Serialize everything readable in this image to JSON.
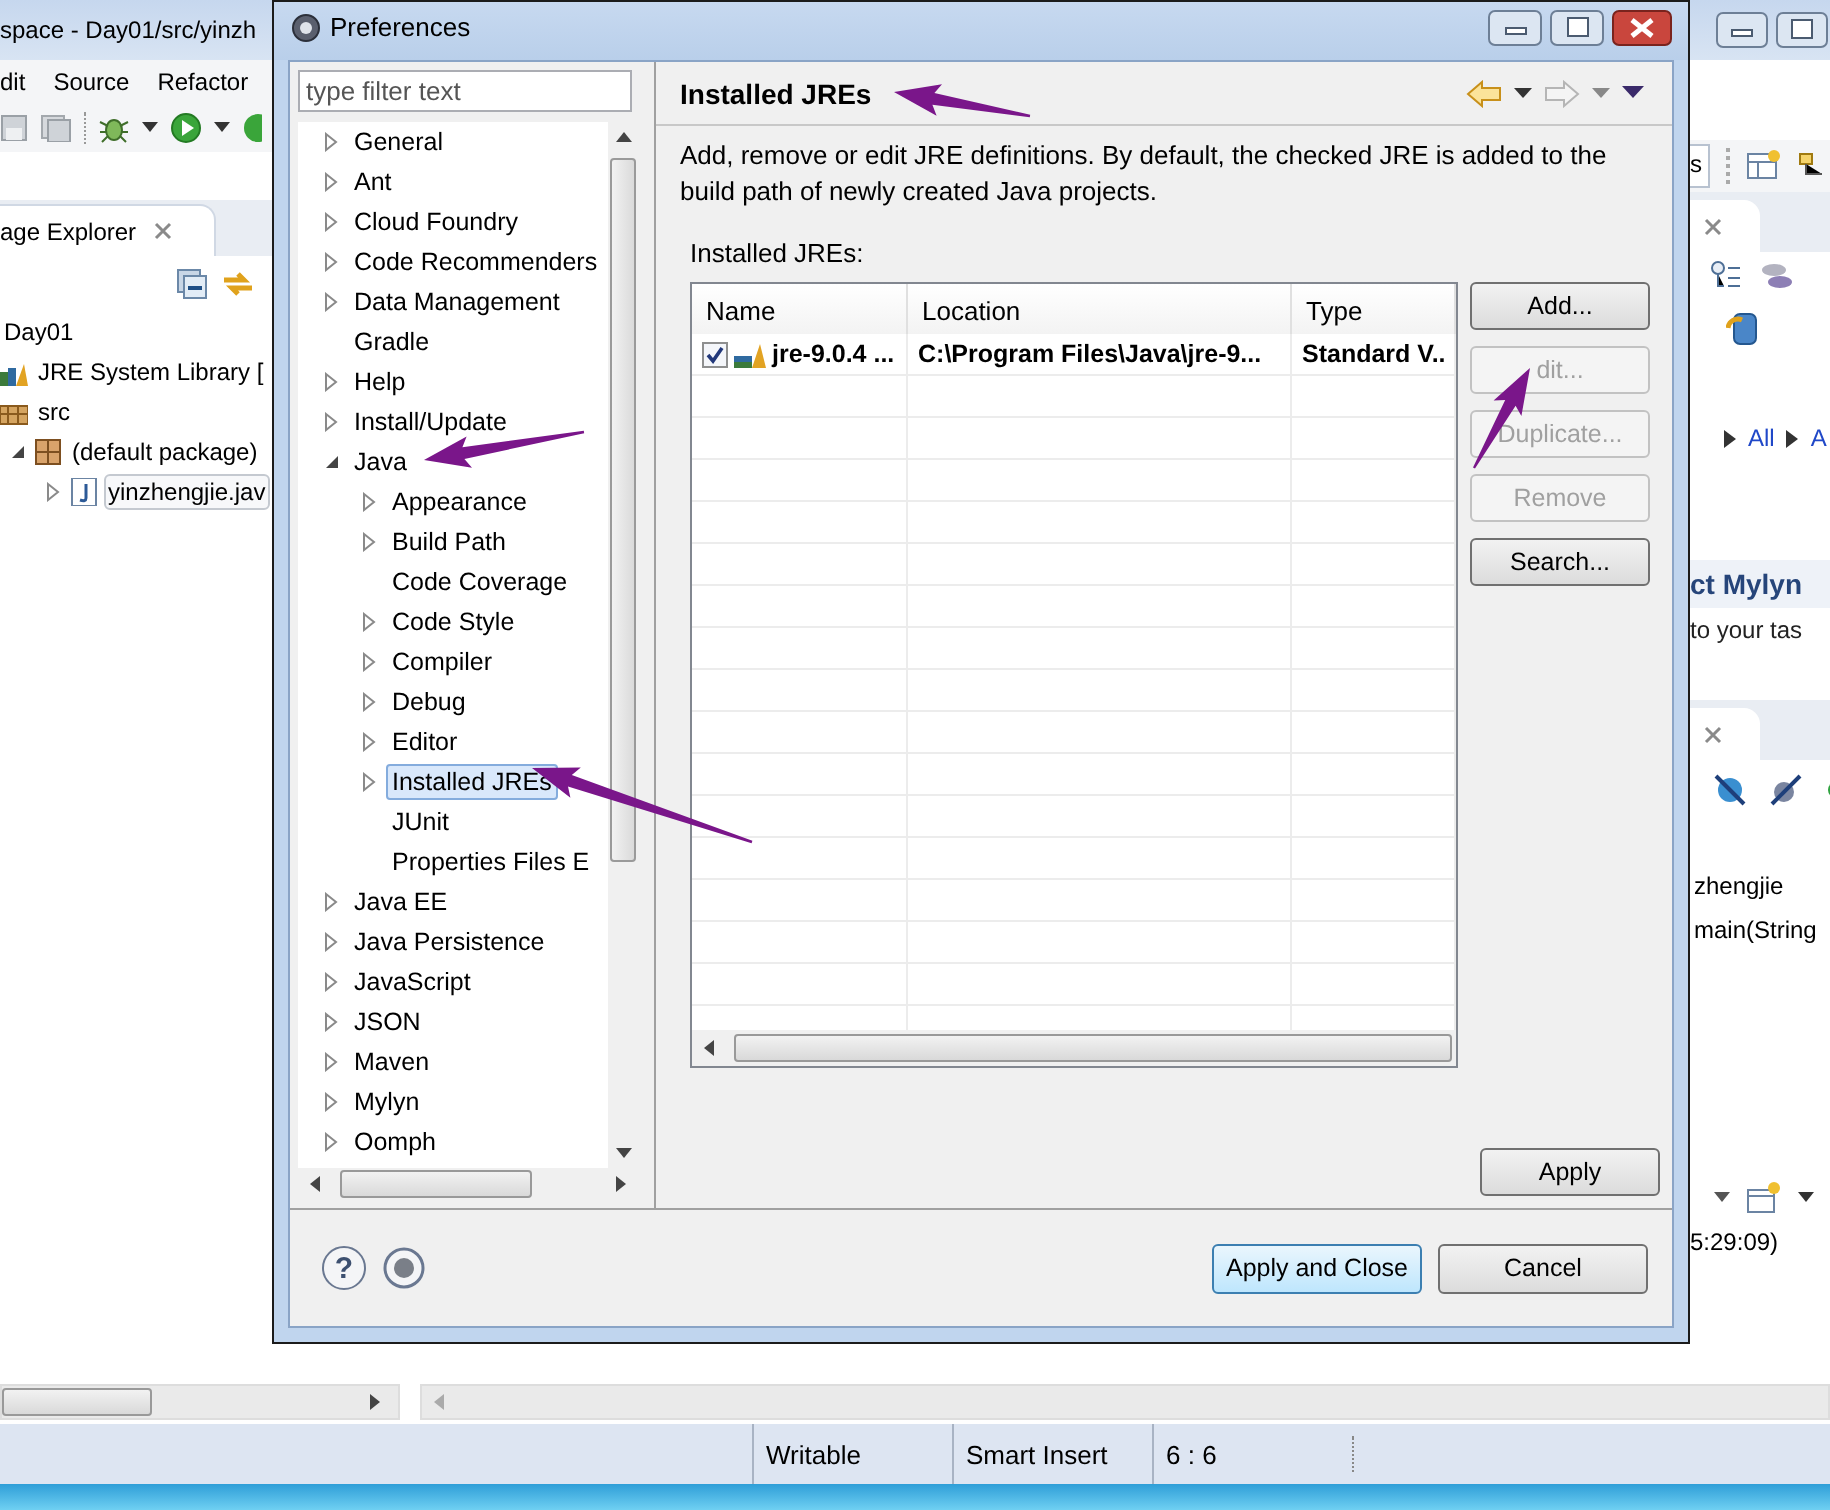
{
  "ide": {
    "title": "space - Day01/src/yinzh",
    "menu": [
      {
        "label": "dit"
      },
      {
        "label": "Source"
      },
      {
        "label": "Refactor"
      }
    ],
    "explorer": {
      "tab": "age Explorer",
      "items": [
        {
          "label": "Day01",
          "kind": "project",
          "selected": false
        },
        {
          "label": "JRE System Library [",
          "kind": "library",
          "selected": false
        },
        {
          "label": "src",
          "kind": "source",
          "selected": false
        },
        {
          "label": "(default package)",
          "kind": "package",
          "expanded": true,
          "selected": false
        },
        {
          "label": "yinzhengjie.jav",
          "kind": "file",
          "expanded": false,
          "selected": true
        }
      ]
    },
    "right": {
      "quick_access": "s",
      "breadcrumbs": [
        "All",
        "A"
      ],
      "mylyn_title": "ct Mylyn",
      "mylyn_text": "to your tas",
      "outline": [
        "zhengjie",
        "main(String"
      ],
      "console_text": "5:29:09)"
    },
    "status_bar": [
      "Writable",
      "Smart Insert",
      "6 : 6"
    ]
  },
  "dialog": {
    "title": "Preferences",
    "filter": {
      "placeholder": "type filter text"
    },
    "tree": [
      {
        "label": "General",
        "kind": "branch",
        "expanded": false,
        "selected": false
      },
      {
        "label": "Ant",
        "kind": "branch",
        "expanded": false,
        "selected": false
      },
      {
        "label": "Cloud Foundry",
        "kind": "branch",
        "expanded": false,
        "selected": false
      },
      {
        "label": "Code Recommenders",
        "kind": "branch",
        "expanded": false,
        "selected": false
      },
      {
        "label": "Data Management",
        "kind": "branch",
        "expanded": false,
        "selected": false
      },
      {
        "label": "Gradle",
        "kind": "leaf",
        "selected": false
      },
      {
        "label": "Help",
        "kind": "branch",
        "expanded": false,
        "selected": false
      },
      {
        "label": "Install/Update",
        "kind": "branch",
        "expanded": false,
        "selected": false
      },
      {
        "label": "Java",
        "kind": "branch",
        "expanded": true,
        "selected": false,
        "children": [
          {
            "label": "Appearance",
            "kind": "branch",
            "expanded": false,
            "selected": false
          },
          {
            "label": "Build Path",
            "kind": "branch",
            "expanded": false,
            "selected": false
          },
          {
            "label": "Code Coverage",
            "kind": "leaf",
            "selected": false
          },
          {
            "label": "Code Style",
            "kind": "branch",
            "expanded": false,
            "selected": false
          },
          {
            "label": "Compiler",
            "kind": "branch",
            "expanded": false,
            "selected": false
          },
          {
            "label": "Debug",
            "kind": "branch",
            "expanded": false,
            "selected": false
          },
          {
            "label": "Editor",
            "kind": "branch",
            "expanded": false,
            "selected": false
          },
          {
            "label": "Installed JREs",
            "kind": "branch",
            "expanded": false,
            "selected": true
          },
          {
            "label": "JUnit",
            "kind": "leaf",
            "selected": false
          },
          {
            "label": "Properties Files E",
            "kind": "leaf",
            "selected": false
          }
        ]
      },
      {
        "label": "Java EE",
        "kind": "branch",
        "expanded": false,
        "selected": false
      },
      {
        "label": "Java Persistence",
        "kind": "branch",
        "expanded": false,
        "selected": false
      },
      {
        "label": "JavaScript",
        "kind": "branch",
        "expanded": false,
        "selected": false
      },
      {
        "label": "JSON",
        "kind": "branch",
        "expanded": false,
        "selected": false
      },
      {
        "label": "Maven",
        "kind": "branch",
        "expanded": false,
        "selected": false
      },
      {
        "label": "Mylyn",
        "kind": "branch",
        "expanded": false,
        "selected": false
      },
      {
        "label": "Oomph",
        "kind": "branch",
        "expanded": false,
        "selected": false
      }
    ],
    "page": {
      "title": "Installed JREs",
      "description": "Add, remove or edit JRE definitions. By default, the checked JRE is added to the build path of newly created Java projects.",
      "table_label": "Installed JREs:",
      "columns": [
        "Name",
        "Location",
        "Type"
      ],
      "rows": [
        {
          "checked": true,
          "selected": false,
          "cells": [
            "jre-9.0.4 ...",
            "C:\\Program Files\\Java\\jre-9...",
            "Standard V.."
          ]
        }
      ],
      "buttons": [
        {
          "label": "Add...",
          "disabled": false
        },
        {
          "label": "dit...",
          "disabled": true
        },
        {
          "label": "Duplicate...",
          "disabled": true
        },
        {
          "label": "Remove",
          "disabled": true
        },
        {
          "label": "Search...",
          "disabled": false
        }
      ],
      "apply": "Apply"
    },
    "footer": {
      "help": "?",
      "buttons": [
        {
          "label": "Apply and Close",
          "default": true
        },
        {
          "label": "Cancel",
          "default": false
        }
      ]
    }
  },
  "annotations": [
    {
      "kind": "arrow"
    },
    {
      "kind": "arrow"
    },
    {
      "kind": "arrow"
    },
    {
      "kind": "arrow"
    }
  ]
}
